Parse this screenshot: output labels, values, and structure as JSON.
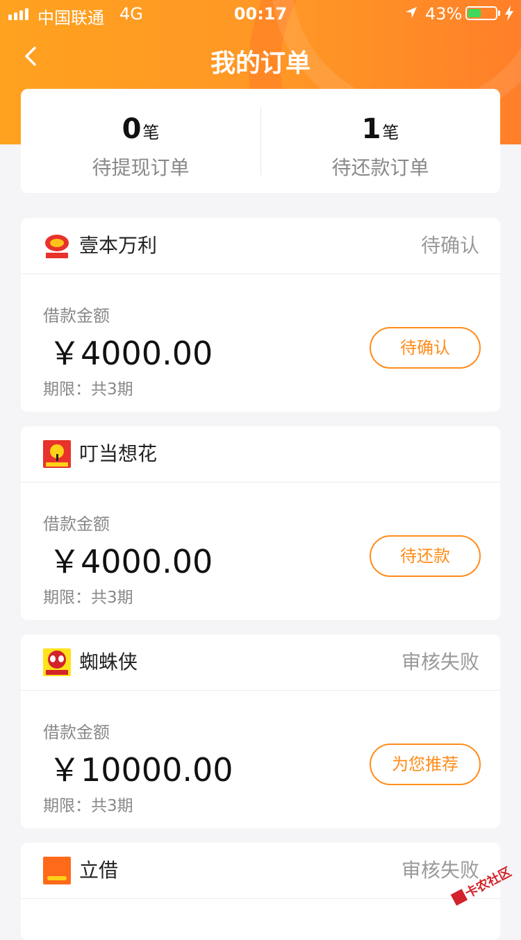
{
  "status_bar": {
    "carrier": "中国联通",
    "network": "4G",
    "time": "00:17",
    "battery_percent": "43%",
    "icons": [
      "signal-icon",
      "location-arrow-icon",
      "battery-icon",
      "charging-bolt-icon"
    ]
  },
  "nav": {
    "title": "我的订单",
    "back_icon": "chevron-left-icon"
  },
  "summary": [
    {
      "count": "0",
      "unit": "笔",
      "label": "待提现订单"
    },
    {
      "count": "1",
      "unit": "笔",
      "label": "待还款订单"
    }
  ],
  "orders": [
    {
      "lender": "壹本万利",
      "status": "待确认",
      "amount_label": "借款金额",
      "amount": "￥4000.00",
      "term": "期限：共3期",
      "action": "待确认",
      "logo_icon": "yibenwanli-logo"
    },
    {
      "lender": "叮当想花",
      "status": "",
      "amount_label": "借款金额",
      "amount": "￥4000.00",
      "term": "期限：共3期",
      "action": "待还款",
      "logo_icon": "dingdang-bell-logo"
    },
    {
      "lender": "蜘蛛侠",
      "status": "审核失败",
      "amount_label": "借款金额",
      "amount": "￥10000.00",
      "term": "期限：共3期",
      "action": "为您推荐",
      "logo_icon": "spider-logo"
    },
    {
      "lender": "立借",
      "status": "审核失败",
      "logo_icon": "lijie-logo"
    }
  ],
  "watermark": {
    "text": "卡农社区"
  },
  "colors": {
    "brand_orange": "#ff8c1a",
    "header_gradient_start": "#ffa21f",
    "header_gradient_end": "#ff7f28"
  }
}
